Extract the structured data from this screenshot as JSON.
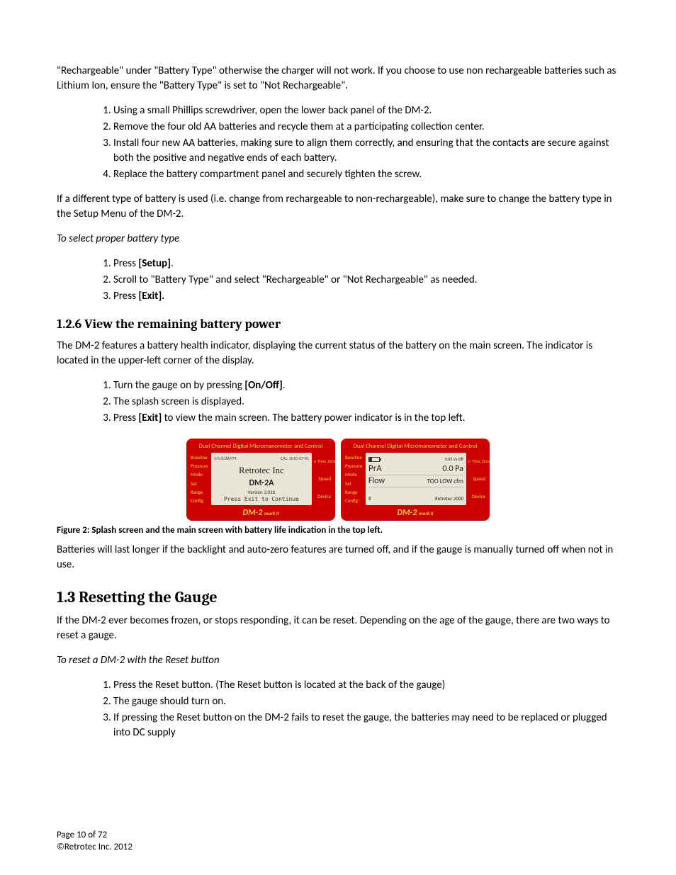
{
  "intro_para": "\"Rechargeable\" under \"Battery Type\" otherwise the charger will not work.  If you choose to use non rechargeable batteries such as Lithium Ion, ensure the \"Battery Type\" is set to \"Not Rechargeable\".",
  "battery_steps": [
    "Using a small Phillips screwdriver, open the lower back panel of the DM-2.",
    "Remove the four old AA batteries and recycle them at a participating collection center.",
    "Install four new AA batteries, making sure to align them correctly, and ensuring that the contacts are secure against both the positive and negative ends of each battery.",
    "Replace the battery compartment panel and securely tighten the screw."
  ],
  "after_steps_para": "If a different type of battery is used (i.e.  change from rechargeable to non-rechargeable), make sure to change the battery type in the Setup Menu of the DM-2.",
  "select_battery_heading": "To select proper battery type",
  "select_steps": [
    {
      "pre": "Press ",
      "bold": "[Setup]",
      "post": "."
    },
    {
      "pre": "Scroll to \"Battery Type\" and select \"Rechargeable\" or \"Not Rechargeable\" as needed.",
      "bold": "",
      "post": ""
    },
    {
      "pre": "Press ",
      "bold": "[Exit].",
      "post": ""
    }
  ],
  "section_126": "1.2.6 View the remaining battery power",
  "para_126": "The DM-2 features a battery health indicator, displaying the current status of the battery on the main screen.  The indicator is located in the upper-left corner of the display.",
  "view_steps": [
    {
      "pre": "Turn the gauge on by pressing ",
      "bold": "[On/Off]",
      "post": "."
    },
    {
      "pre": "The splash screen is displayed.",
      "bold": "",
      "post": ""
    },
    {
      "pre": "Press ",
      "bold": "[Exit]",
      "post": " to view the main screen.  The battery power indicator is in the top left."
    }
  ],
  "figure_caption": "Figure 2:  Splash screen and the main screen with battery life indication in the top left.",
  "para_batteries_longer": "Batteries will last longer if the backlight and auto-zero features are turned off, and if the gauge is manually turned off when not in use.",
  "section_13": "1.3  Resetting the Gauge",
  "para_13": "If the DM-2 ever becomes frozen, or stops responding, it can be reset.  Depending on the age of the gauge, there are two ways to reset a gauge.",
  "reset_heading": "To reset a DM-2 with the Reset button",
  "reset_steps": [
    "Press the Reset button.  (The Reset button is located at the back of the gauge)",
    "The gauge should turn on.",
    "If pressing the Reset button on the DM-2 fails to reset the gauge,  the batteries may need to be replaced or plugged into DC supply"
  ],
  "footer_page": "Page 10 of 72",
  "footer_copy": "©Retrotec Inc. 2012",
  "device": {
    "title": "Dual Channel Digital Micromanometer and Control",
    "left": [
      "Baseline",
      "Pressure",
      "Mode",
      "Set",
      "Range",
      "Config"
    ],
    "right_top": [
      "n",
      "Time",
      "Zero"
    ],
    "right": [
      "Speed",
      "Device"
    ],
    "splash": {
      "sn": "S/N 8186979",
      "cal": "CAL: 2010-07-01",
      "brand": "Retrotec Inc",
      "model": "DM-2A",
      "version": "Version 3.01b",
      "exit": "Press Exit to Continue"
    },
    "main": {
      "top_right": "0.65   2s   Off",
      "row1_l": "PrA",
      "row1_r": "0.0 Pa",
      "row2_l": "Flow",
      "row2_r": "TOO LOW cfm",
      "bottom_l": "8",
      "bottom_r": "Retrotec 2000"
    },
    "footer": "DM-2",
    "footer_mark": "mark II"
  }
}
